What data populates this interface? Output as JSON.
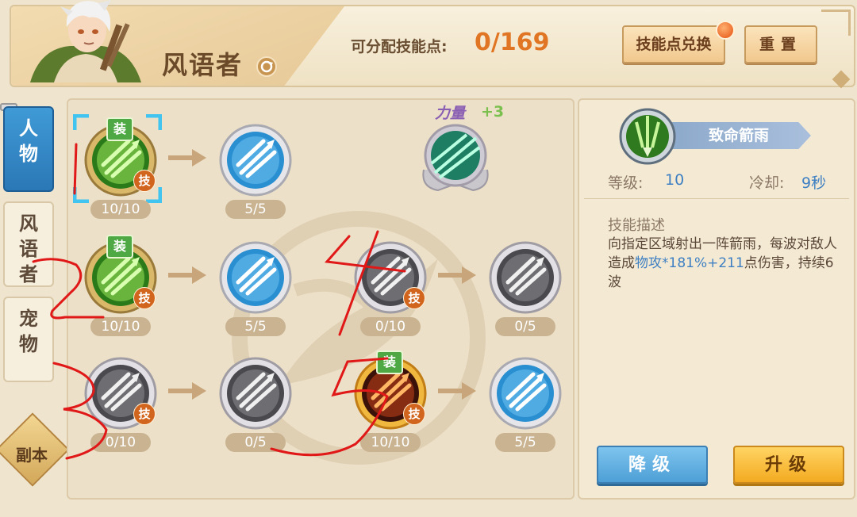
{
  "header": {
    "class_name": "风语者",
    "points_label": "可分配技能点:",
    "points_value": "0/169",
    "exchange_button": "技能点兑换",
    "reset_button": "重置"
  },
  "tabs": [
    {
      "label": "人物",
      "active": true
    },
    {
      "label": "风语者",
      "active": false
    },
    {
      "label": "宠物",
      "active": false
    },
    {
      "label": "副本",
      "active": false
    }
  ],
  "tree": {
    "power_label": "力量",
    "power_bonus": "+3",
    "equip_badge": "装",
    "tech_badge": "技",
    "nodes": [
      {
        "id": "r1c1",
        "level": "10/10",
        "equipped": true,
        "tech": true,
        "selected": true,
        "theme": "green",
        "icon": "arrow-rain-icon"
      },
      {
        "id": "r1c2",
        "level": "5/5",
        "equipped": false,
        "tech": false,
        "theme": "blue",
        "icon": "multi-arrow-icon"
      },
      {
        "id": "r2c1",
        "level": "10/10",
        "equipped": true,
        "tech": true,
        "theme": "green",
        "icon": "volley-icon"
      },
      {
        "id": "r2c2",
        "level": "5/5",
        "equipped": false,
        "tech": false,
        "theme": "blue",
        "icon": "piercing-arrow-icon"
      },
      {
        "id": "r2c3",
        "level": "0/10",
        "equipped": false,
        "tech": true,
        "theme": "gray",
        "icon": "wind-swirl-icon"
      },
      {
        "id": "r2c4",
        "level": "0/5",
        "equipped": false,
        "tech": false,
        "theme": "gray",
        "icon": "broken-arrow-icon"
      },
      {
        "id": "r3c1",
        "level": "0/10",
        "equipped": false,
        "tech": true,
        "theme": "gray",
        "icon": "wind-slash-icon"
      },
      {
        "id": "r3c2",
        "level": "0/5",
        "equipped": false,
        "tech": false,
        "theme": "gray",
        "icon": "trident-arrow-icon"
      },
      {
        "id": "r3c3",
        "level": "10/10",
        "equipped": true,
        "tech": true,
        "theme": "fire",
        "icon": "fire-burst-icon"
      },
      {
        "id": "r3c4",
        "level": "5/5",
        "equipped": false,
        "tech": false,
        "theme": "blue",
        "icon": "swift-boot-icon"
      }
    ]
  },
  "detail": {
    "skill_name": "致命箭雨",
    "level_label": "等级:",
    "level_value": "10",
    "cooldown_label": "冷却:",
    "cooldown_value": "9秒",
    "desc_heading": "技能描述",
    "desc_part1": "向指定区域射出一阵箭雨，每波对敌人造成",
    "desc_highlight": "物攻*181%+211",
    "desc_part2": "点伤害，持续6波",
    "downgrade_button": "降级",
    "upgrade_button": "升级"
  },
  "annotations": [
    "1",
    "2",
    "3",
    "4",
    "5"
  ],
  "colors": {
    "accent_orange": "#e07624",
    "highlight_blue": "#3d7fc2",
    "equip_green": "#4ea843",
    "annotation_red": "#e01818"
  }
}
